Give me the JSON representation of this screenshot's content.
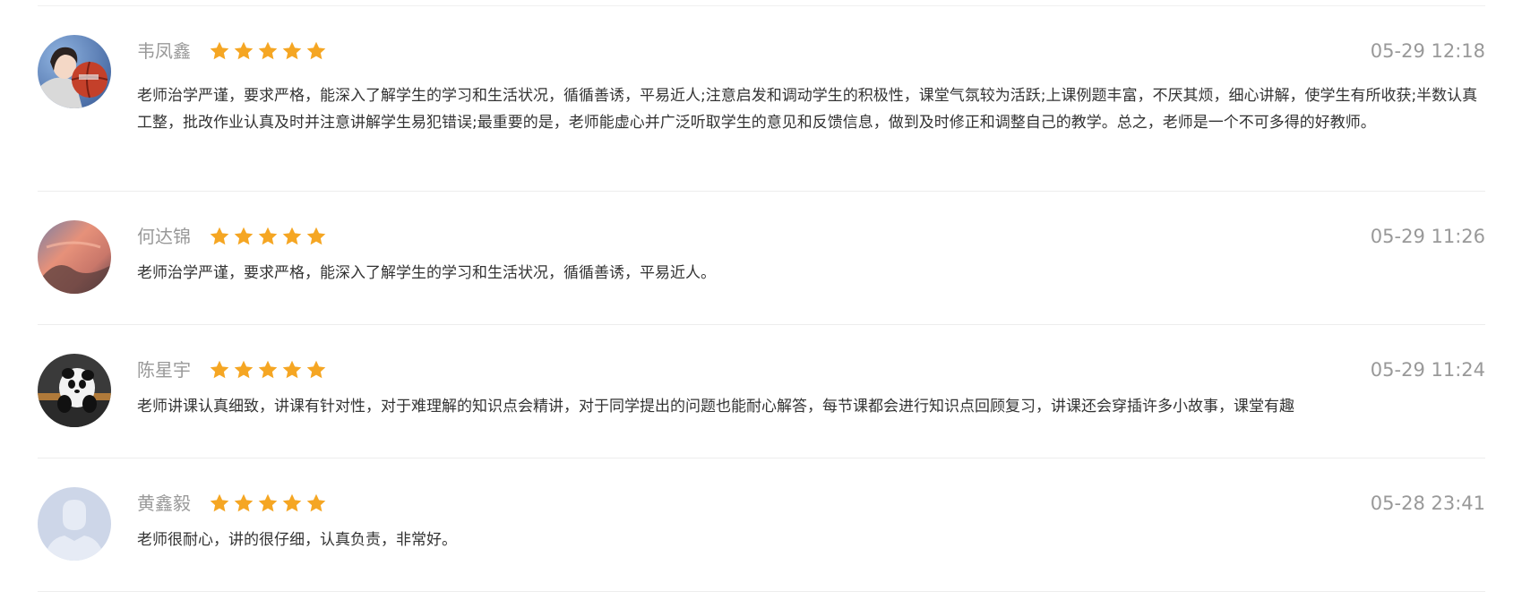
{
  "reviews": [
    {
      "username": "韦凤鑫",
      "rating": 5,
      "time": "05-29 12:18",
      "avatar_icon": "girl-with-basketball-photo",
      "content": "老师治学严谨，要求严格，能深入了解学生的学习和生活状况，循循善诱，平易近人;注意启发和调动学生的积极性，课堂气氛较为活跃;上课例题丰富，不厌其烦，细心讲解，使学生有所收获;半数认真工整，批改作业认真及时并注意讲解学生易犯错误;最重要的是，老师能虚心并广泛听取学生的意见和反馈信息，做到及时修正和调整自己的教学。总之，老师是一个不可多得的好教师。"
    },
    {
      "username": "何达锦",
      "rating": 5,
      "time": "05-29 11:26",
      "avatar_icon": "sunset-photo",
      "content": "老师治学严谨，要求严格，能深入了解学生的学习和生活状况，循循善诱，平易近人。"
    },
    {
      "username": "陈星宇",
      "rating": 5,
      "time": "05-29 11:24",
      "avatar_icon": "panda-plush-photo",
      "content": "老师讲课认真细致，讲课有针对性，对于难理解的知识点会精讲，对于同学提出的问题也能耐心解答，每节课都会进行知识点回顾复习，讲课还会穿插许多小故事，课堂有趣"
    },
    {
      "username": "黄鑫毅",
      "rating": 5,
      "time": "05-28 23:41",
      "avatar_icon": "default-user-avatar-icon",
      "content": "老师很耐心，讲的很仔细，认真负责，非常好。"
    }
  ],
  "colors": {
    "star": "#f5a623",
    "username": "#999999",
    "time": "#999999",
    "content": "#333333",
    "divider": "#ededed",
    "default_avatar_bg": "#cdd6e8"
  }
}
